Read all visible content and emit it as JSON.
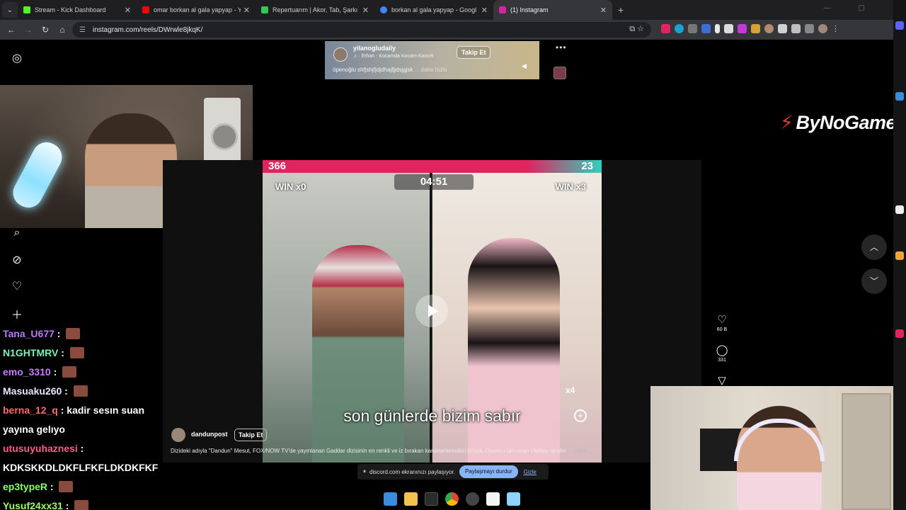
{
  "browser": {
    "tabs": [
      {
        "title": "Stream - Kick Dashboard",
        "color": "#53fc18",
        "active": false
      },
      {
        "title": "omar borkan al gala yapyap - Y",
        "color": "#ff0000",
        "active": false
      },
      {
        "title": "Repertuarım | Akor, Tab, Şarkı S",
        "color": "#34c759",
        "active": false
      },
      {
        "title": "borkan al gala yapyap - Googl",
        "color": "#4285f4",
        "active": false
      },
      {
        "title": "(1) Instagram",
        "color": "#d6249f",
        "active": true
      }
    ],
    "url": "instagram.com/reels/DWrwle8jkqK/",
    "new_tab": "+"
  },
  "mini_reel": {
    "username": "yilanogludaily",
    "song": "♫ · Erhan - Kocamda Kocam-Kancel",
    "follow_label": "Takip Et",
    "caption": "öpenoğlu shfjshjfjdjdhajfjjdsjgjsk",
    "more_label": "... daha fazla"
  },
  "reel": {
    "score_left": "366",
    "score_right": "23",
    "win_left": "WIN x0",
    "win_right": "WIN x3",
    "timer": "04:51",
    "multiplier": "x4",
    "subtitle": "son günlerde bizim sabır",
    "author": "dandunpost",
    "follow_label": "Takip Et",
    "caption": "Dizideki adıyla \"Dandun\" Mesut, FOX/NOW TV'de yayınlanan Gaddar dizisinin en renkli ve iz bırakan karakterlerinden biriydi. Oyuncu Umutcan Ütebay tarafın",
    "more_label": "... daha"
  },
  "actions": {
    "likes": "60 B",
    "comments": "331"
  },
  "brand_overlay": "ByNoGame",
  "chat": [
    {
      "user": "Tana_U677",
      "color": "#b77bff",
      "text": "",
      "emote": true
    },
    {
      "user": "N1GHTMRV",
      "color": "#7ff0b8",
      "text": "",
      "emote": true
    },
    {
      "user": "emo_3310",
      "color": "#c77dff",
      "text": "",
      "emote": true
    },
    {
      "user": "Masuaku260",
      "color": "#e6e6ff",
      "text": "",
      "emote": true
    },
    {
      "user": "berna_12_q",
      "color": "#ff6b6b",
      "text": "kadir sesın suan",
      "emote": false
    },
    {
      "user": "",
      "color": "#ffffff",
      "text": "yayına gelıyo",
      "emote": false
    },
    {
      "user": "utusuyuhaznesi",
      "color": "#ff5c8a",
      "text": "",
      "emote": false
    },
    {
      "user": "",
      "color": "#ffffff",
      "text": "KDKSKKDLDKFLFKFLDKDKFKF",
      "emote": false
    },
    {
      "user": "ep3typeR",
      "color": "#8cff6b",
      "text": "",
      "emote": true
    },
    {
      "user": "Yusuf24xx31",
      "color": "#9cff6b",
      "text": "",
      "emote": true
    }
  ],
  "share_bar": {
    "text": "discord.com ekranınızı paylaşıyor.",
    "stop_label": "Paylaşmayı durdur",
    "hide_label": "Gizle"
  }
}
